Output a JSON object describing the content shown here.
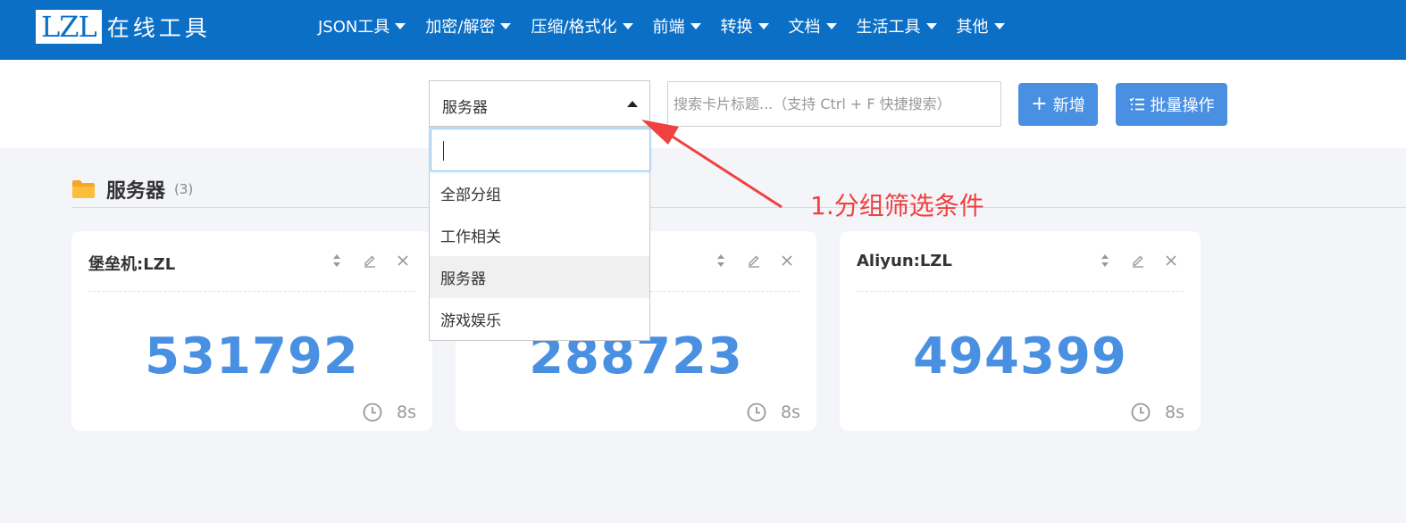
{
  "header": {
    "logo_mark": "LZL",
    "logo_text": "在线工具",
    "nav": [
      {
        "label": "JSON工具"
      },
      {
        "label": "加密/解密"
      },
      {
        "label": "压缩/格式化"
      },
      {
        "label": "前端"
      },
      {
        "label": "转换"
      },
      {
        "label": "文档"
      },
      {
        "label": "生活工具"
      },
      {
        "label": "其他"
      }
    ]
  },
  "toolbar": {
    "group_select_value": "服务器",
    "search_placeholder": "搜索卡片标题...（支持 Ctrl + F 快捷搜索）",
    "add_label": "新增",
    "add_icon": "plus-icon",
    "batch_label": "批量操作",
    "batch_icon": "list-icon"
  },
  "dropdown": {
    "search_value": "",
    "options": [
      {
        "label": "全部分组",
        "selected": false
      },
      {
        "label": "工作相关",
        "selected": false
      },
      {
        "label": "服务器",
        "selected": true
      },
      {
        "label": "游戏娱乐",
        "selected": false
      }
    ]
  },
  "group": {
    "icon": "folder-icon",
    "title": "服务器",
    "count": "(3)"
  },
  "cards": [
    {
      "title": "堡垒机:LZL",
      "code": "531792",
      "timer": "8s"
    },
    {
      "title": "",
      "code": "288723",
      "timer": "8s"
    },
    {
      "title": "Aliyun:LZL",
      "code": "494399",
      "timer": "8s"
    }
  ],
  "annotation": {
    "text": "1.分组筛选条件",
    "color": "#f0403f"
  },
  "colors": {
    "header_bg": "#0b6fc6",
    "accent": "#4a90e2",
    "page_bg": "#f4f5f9"
  }
}
